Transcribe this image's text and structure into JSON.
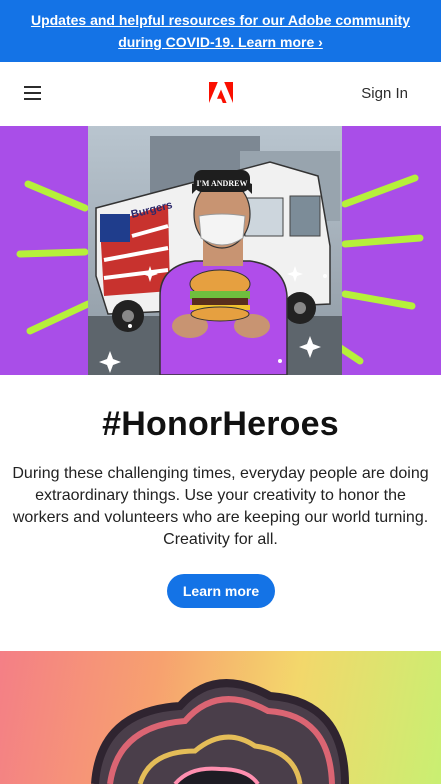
{
  "banner": {
    "text": "Updates and helpful resources for our Adobe community during COVID-19. Learn more ›"
  },
  "header": {
    "menu_icon": "hamburger-menu-icon",
    "logo_icon": "adobe-logo-icon",
    "sign_in": "Sign In"
  },
  "hero": {
    "truck_cap_text": "I'M ANDREW",
    "truck_side_text": "Burgers"
  },
  "main": {
    "title": "#HonorHeroes",
    "description": "During these challenging times, everyday people are doing extraordinary things. Use your creativity to honor the workers and volunteers who are keeping our world turning. Creativity for all.",
    "cta": "Learn more"
  },
  "colors": {
    "brand_blue": "#1473e6",
    "hero_purple": "#a94ee8",
    "adobe_red": "#fa0f00"
  }
}
